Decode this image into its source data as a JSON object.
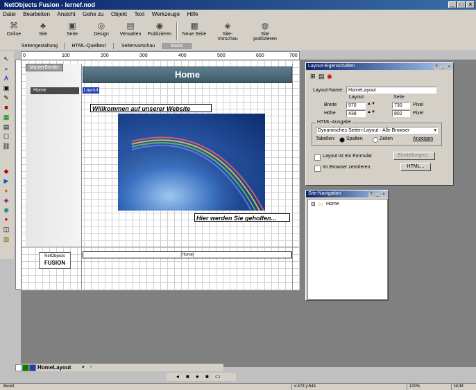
{
  "app": {
    "title": "NetObjects Fusion - lernef.nod"
  },
  "window_controls": {
    "min": "_",
    "max": "□",
    "close": "×"
  },
  "menu": [
    "Datei",
    "Bearbeiten",
    "Ansicht",
    "Gehe zu",
    "Objekt",
    "Text",
    "Werkzeuge",
    "Hilfe"
  ],
  "toolbar": [
    {
      "label": "Online",
      "icon": "globe-icon"
    },
    {
      "label": "Site",
      "icon": "sitemap-icon"
    },
    {
      "label": "Seite",
      "icon": "page-icon"
    },
    {
      "label": "Design",
      "icon": "palette-icon"
    },
    {
      "label": "Verwalten",
      "icon": "assets-icon"
    },
    {
      "label": "Publizieren",
      "icon": "publish-icon"
    },
    {
      "label": "Neue Seite",
      "icon": "new-page-icon"
    },
    {
      "label": "Site-Vorschau",
      "icon": "preview-icon"
    },
    {
      "label": "Site publizieren",
      "icon": "publish-site-icon"
    }
  ],
  "view_tabs": [
    "Seitengestaltung",
    "HTML-Quelltext",
    "Seitenvorschau",
    "Basis"
  ],
  "ruler": [
    "0",
    "100",
    "200",
    "300",
    "400",
    "500",
    "600",
    "700"
  ],
  "page": {
    "master_label": "MasterBorder",
    "banner": "Home",
    "nav_button": "Home",
    "layout_tag": "Layout",
    "welcome_text": "Willkommen auf unserer Website",
    "helped_text": "Hier werden Sie geholfen...",
    "footer_text": "[Home]",
    "logo_top": "NetObjects",
    "logo_bottom": "FUSION"
  },
  "layout_props": {
    "title": "Layout-Eigenschaften",
    "name_label": "Layout-Name:",
    "name_value": "HomeLayout",
    "layout_hdr": "Layout",
    "seite_hdr": "Seite",
    "width_label": "Breite",
    "height_label": "Höhe",
    "width_layout": "570",
    "height_layout": "438",
    "width_page": "730",
    "height_page": "802",
    "unit": "Pixel",
    "html_group": "HTML-Ausgabe",
    "html_select": "Dynamisches Seiten-Layout - Alle Browser",
    "tables_label": "Tabellen:",
    "radio_cols": "Spalten",
    "radio_rows": "Zeilen",
    "show_link": "Anzeigen",
    "form_check": "Layout ist ein Formular",
    "center_check": "Im Browser zentrieren",
    "settings_btn": "Einstellungen...",
    "html_btn": "HTML..."
  },
  "site_nav": {
    "title": "Site-Navigation",
    "item": "Home"
  },
  "bottom": {
    "page_tab": "HomeLayout"
  },
  "status": {
    "left": "Bereit",
    "coords": "x:478  y:544",
    "zoom": "100%",
    "caps": "NUM"
  }
}
